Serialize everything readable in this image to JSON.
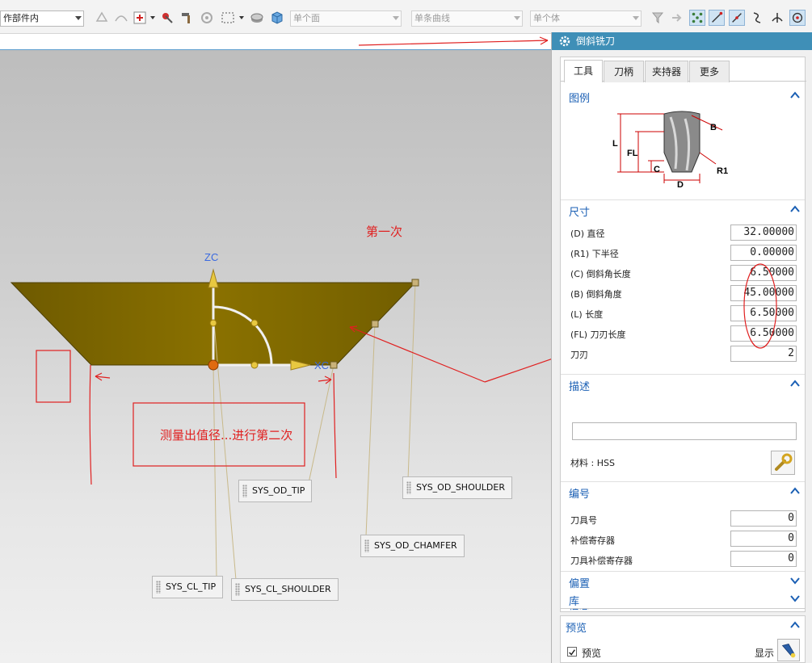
{
  "toolbar": {
    "selection_filter": "作部件内",
    "face_rule": "单个面",
    "curve_rule": "单条曲线",
    "body_rule": "单个体"
  },
  "viewport": {
    "annotation_first": "第一次",
    "annotation_measure": "测量出值径...进行第二次",
    "axis_zc": "ZC",
    "axis_xc": "XC",
    "tags": {
      "od_tip": "SYS_OD_TIP",
      "od_shoulder": "SYS_OD_SHOULDER",
      "od_chamfer": "SYS_OD_CHAMFER",
      "cl_tip": "SYS_CL_TIP",
      "cl_shoulder": "SYS_CL_SHOULDER"
    }
  },
  "dialog": {
    "title": "倒斜铣刀",
    "tabs": [
      "工具",
      "刀柄",
      "夹持器",
      "更多"
    ],
    "legend": {
      "title": "图例",
      "labels": {
        "l": "L",
        "fl": "FL",
        "c": "C",
        "d": "D",
        "b": "B",
        "r1": "R1"
      }
    },
    "dimensions": {
      "title": "尺寸",
      "params": [
        {
          "label": "(D) 直径",
          "value": "32.00000"
        },
        {
          "label": "(R1) 下半径",
          "value": "0.00000"
        },
        {
          "label": "(C) 倒斜角长度",
          "value": "6.50000"
        },
        {
          "label": "(B) 倒斜角度",
          "value": "45.00000"
        },
        {
          "label": "(L) 长度",
          "value": "6.50000"
        },
        {
          "label": "(FL) 刀刃长度",
          "value": "6.50000"
        },
        {
          "label": "刀刃",
          "value": "2"
        }
      ]
    },
    "description": {
      "title": "描述",
      "value": "",
      "material": "材料 : HSS"
    },
    "numbering": {
      "title": "编号",
      "fields": [
        {
          "label": "刀具号",
          "value": "0"
        },
        {
          "label": "补偿寄存器",
          "value": "0"
        },
        {
          "label": "刀具补偿寄存器",
          "value": "0"
        }
      ]
    },
    "collapsed": [
      "偏置",
      "信息",
      "库"
    ],
    "preview": {
      "title": "预览",
      "checkbox_label": "预览",
      "checked": true,
      "show_label": "显示"
    }
  },
  "colors": {
    "annotation": "#e02020",
    "tool_body": "#7a6300",
    "dialog_title_bar": "#3f8fb7",
    "section_title": "#1a5fb4"
  }
}
